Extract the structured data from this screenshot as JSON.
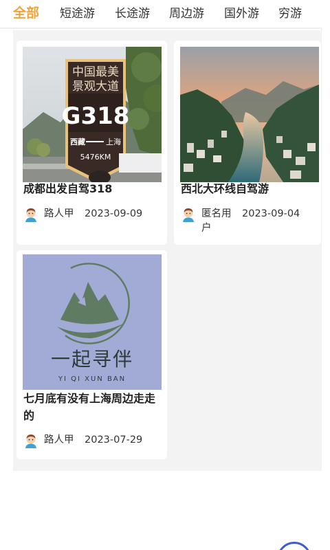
{
  "tabs": [
    {
      "label": "全部",
      "active": true
    },
    {
      "label": "短途游",
      "active": false
    },
    {
      "label": "长途游",
      "active": false
    },
    {
      "label": "周边游",
      "active": false
    },
    {
      "label": "国外游",
      "active": false
    },
    {
      "label": "穷游",
      "active": false
    }
  ],
  "posts": [
    {
      "title": "成都出发自驾318",
      "author": "路人甲",
      "date": "2023-09-09",
      "sign": {
        "line1": "中国最美",
        "line2": "景观大道",
        "road": "G318",
        "left": "西藏",
        "right": "上海",
        "km": "5476KM"
      }
    },
    {
      "title": "西北大环线自驾游",
      "author": "匿名用户",
      "date": "2023-09-04"
    },
    {
      "title": "七月底有没有上海周边走走的",
      "author": "路人甲",
      "date": "2023-07-29",
      "logo": {
        "name": "一起寻伴",
        "pinyin": "YI QI XUN BAN"
      }
    }
  ],
  "colors": {
    "accent": "#f0a33a",
    "background": "#f3f3f3",
    "card": "#ffffff",
    "fab_ring": "#3d5ccf"
  },
  "icons": {
    "avatar": "user-avatar-icon"
  }
}
